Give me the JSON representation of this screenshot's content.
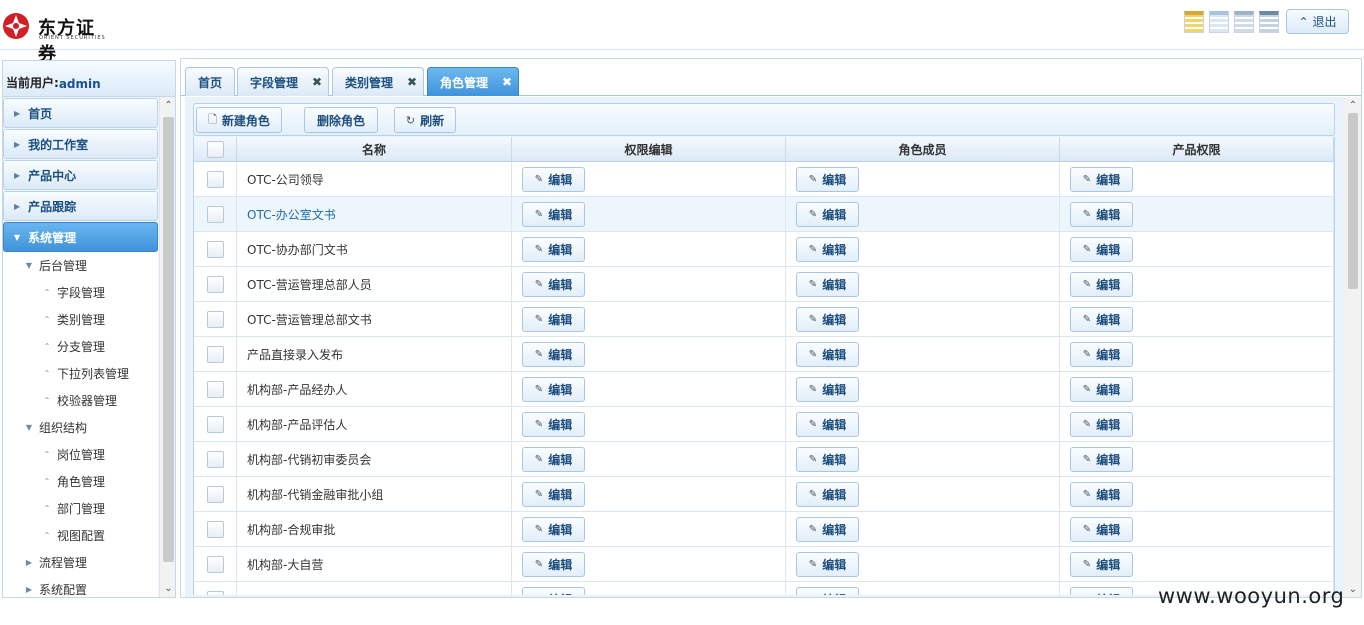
{
  "header": {
    "logo_cn": "东方证券",
    "logo_en": "ORIENT SECURITIES",
    "logout_label": "退出",
    "theme_icons": [
      "theme-yellow-icon",
      "theme-lightblue-icon",
      "theme-gray-icon",
      "theme-blue-icon"
    ]
  },
  "sidebar": {
    "user_label": "当前用户:",
    "user_name": "admin",
    "sections": [
      {
        "label": "首页"
      },
      {
        "label": "我的工作室"
      },
      {
        "label": "产品中心"
      },
      {
        "label": "产品跟踪"
      }
    ],
    "active_section": "系统管理",
    "tree": [
      {
        "label": "后台管理",
        "level": 1,
        "expanded": true
      },
      {
        "label": "字段管理",
        "level": 2
      },
      {
        "label": "类别管理",
        "level": 2
      },
      {
        "label": "分支管理",
        "level": 2
      },
      {
        "label": "下拉列表管理",
        "level": 2
      },
      {
        "label": "校验器管理",
        "level": 2
      },
      {
        "label": "组织结构",
        "level": 1,
        "expanded": true
      },
      {
        "label": "岗位管理",
        "level": 2
      },
      {
        "label": "角色管理",
        "level": 2
      },
      {
        "label": "部门管理",
        "level": 2
      },
      {
        "label": "视图配置",
        "level": 2
      },
      {
        "label": "流程管理",
        "level": 1,
        "expanded": false
      },
      {
        "label": "系统配置",
        "level": 1,
        "expanded": false
      }
    ]
  },
  "tabs": [
    {
      "label": "首页",
      "closable": false
    },
    {
      "label": "字段管理",
      "closable": true
    },
    {
      "label": "类别管理",
      "closable": true
    },
    {
      "label": "角色管理",
      "closable": true,
      "active": true
    }
  ],
  "toolbar": {
    "new_role": "新建角色",
    "delete_role": "删除角色",
    "refresh": "刷新"
  },
  "table": {
    "columns": [
      "名称",
      "权限编辑",
      "角色成员",
      "产品权限"
    ],
    "edit_label": "编辑",
    "rows": [
      {
        "name": "OTC-公司领导"
      },
      {
        "name": "OTC-办公室文书",
        "highlight": true
      },
      {
        "name": "OTC-协办部门文书"
      },
      {
        "name": "OTC-营运管理总部人员"
      },
      {
        "name": "OTC-营运管理总部文书"
      },
      {
        "name": "产品直接录入发布"
      },
      {
        "name": "机构部-产品经办人"
      },
      {
        "name": "机构部-产品评估人"
      },
      {
        "name": "机构部-代销初审委员会"
      },
      {
        "name": "机构部-代销金融审批小组"
      },
      {
        "name": "机构部-合规审批"
      },
      {
        "name": "机构部-大自营"
      },
      {
        "name": ""
      }
    ]
  },
  "watermark": "www.wooyun.org"
}
